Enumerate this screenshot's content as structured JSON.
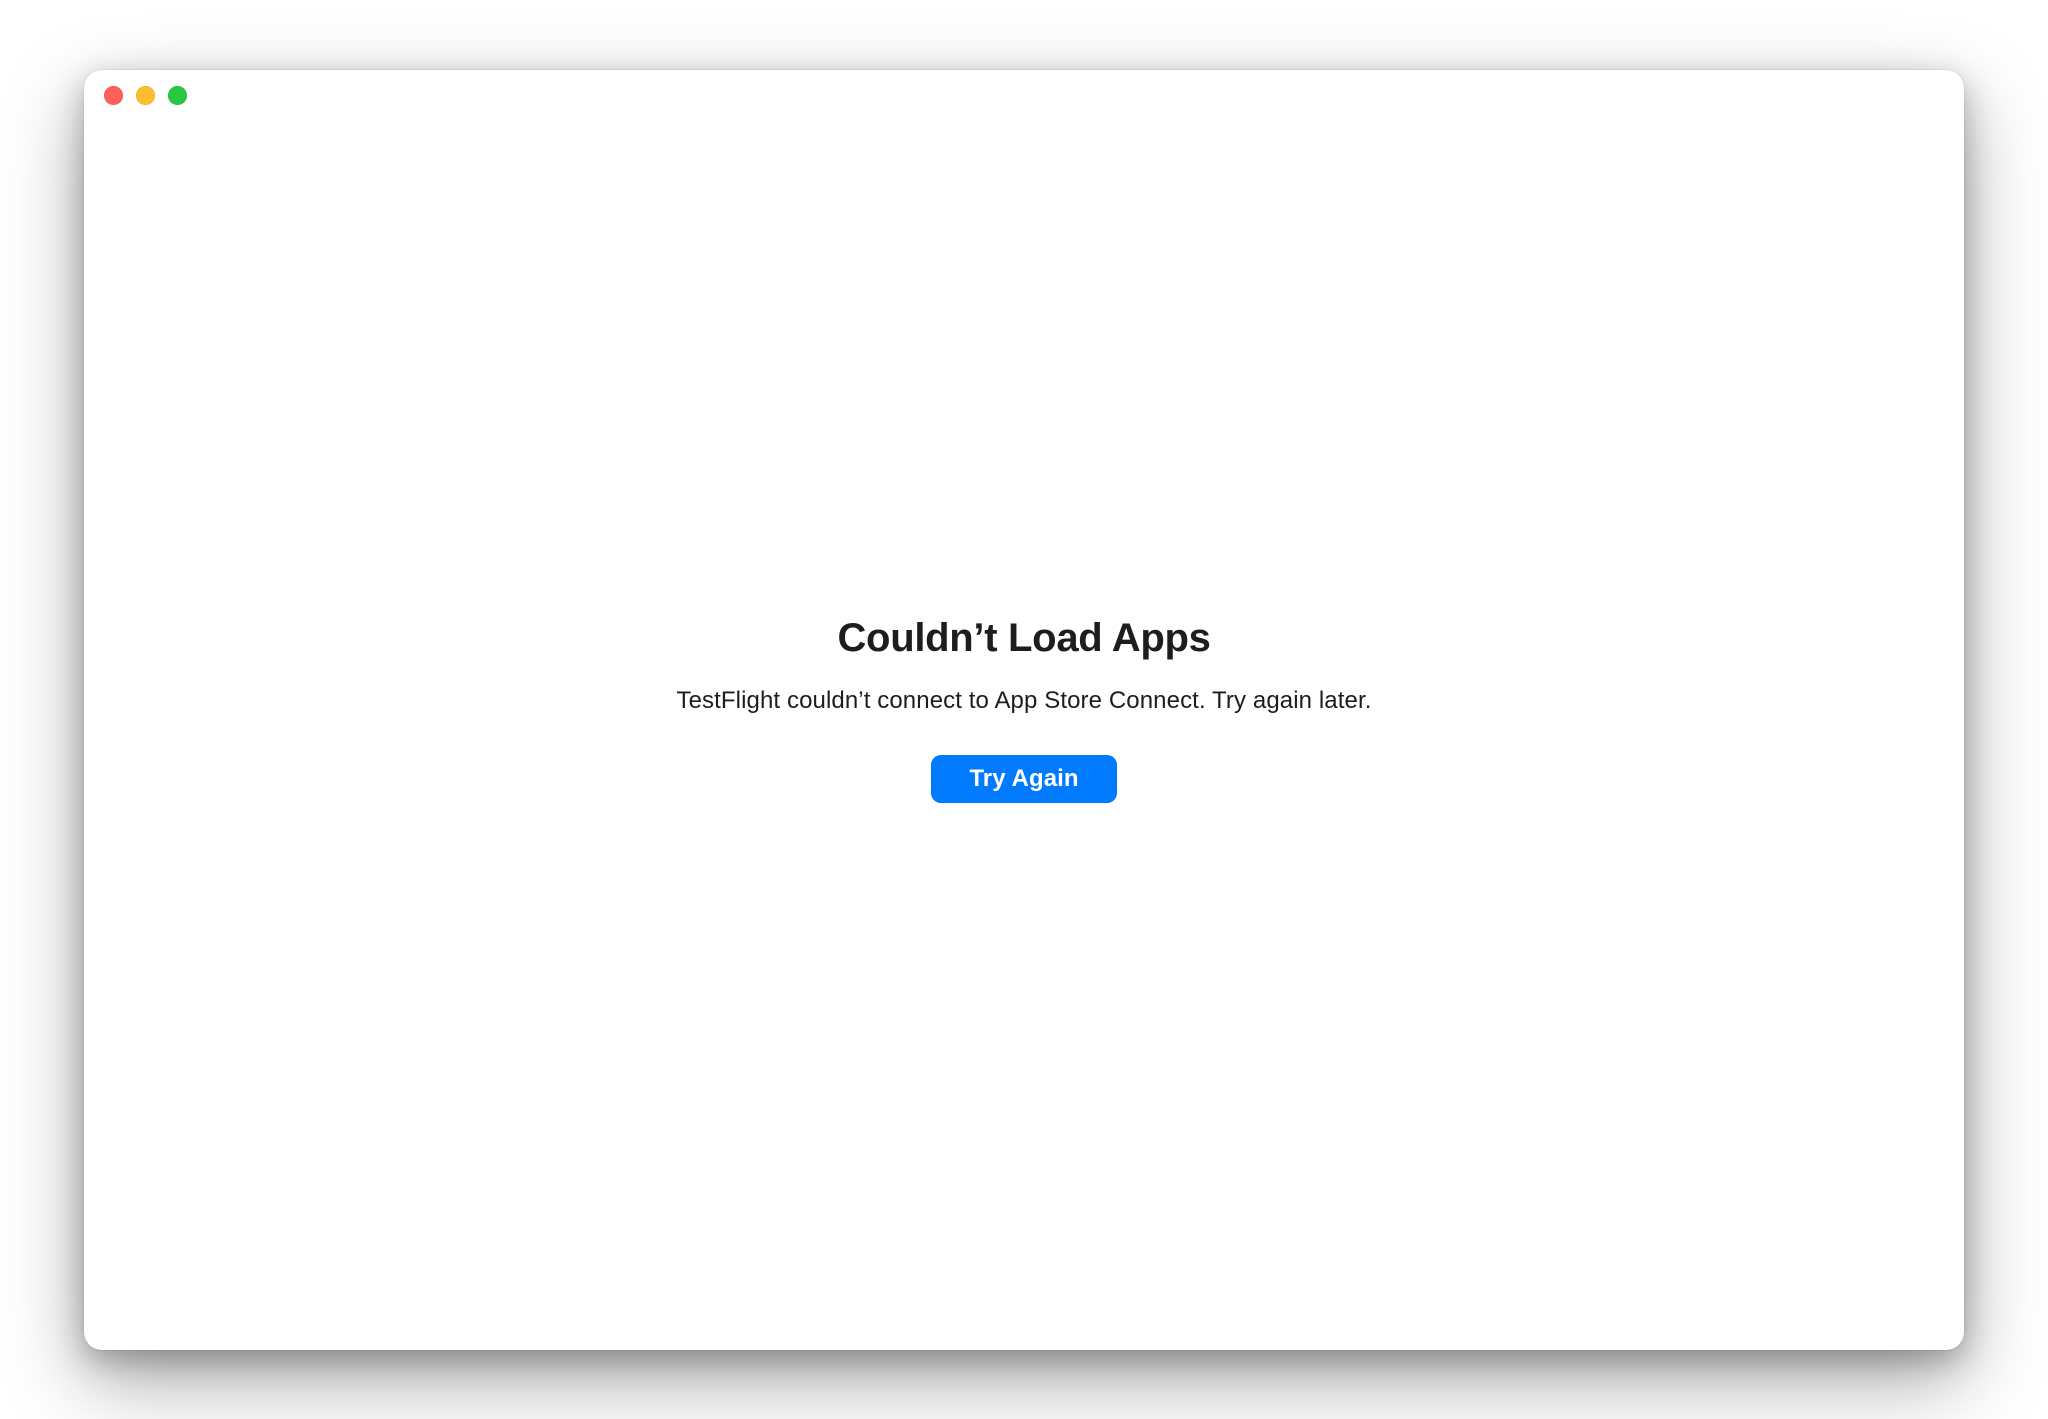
{
  "window": {
    "traffic_lights": {
      "close": "close",
      "minimize": "minimize",
      "maximize": "maximize"
    }
  },
  "error": {
    "title": "Couldn’t Load Apps",
    "message": "TestFlight couldn’t connect to App Store Connect. Try again later.",
    "button_label": "Try Again"
  },
  "colors": {
    "accent": "#007aff",
    "text_primary": "#1d1d1f",
    "traffic_red": "#ff5f57",
    "traffic_yellow": "#febc2e",
    "traffic_green": "#28c840"
  }
}
